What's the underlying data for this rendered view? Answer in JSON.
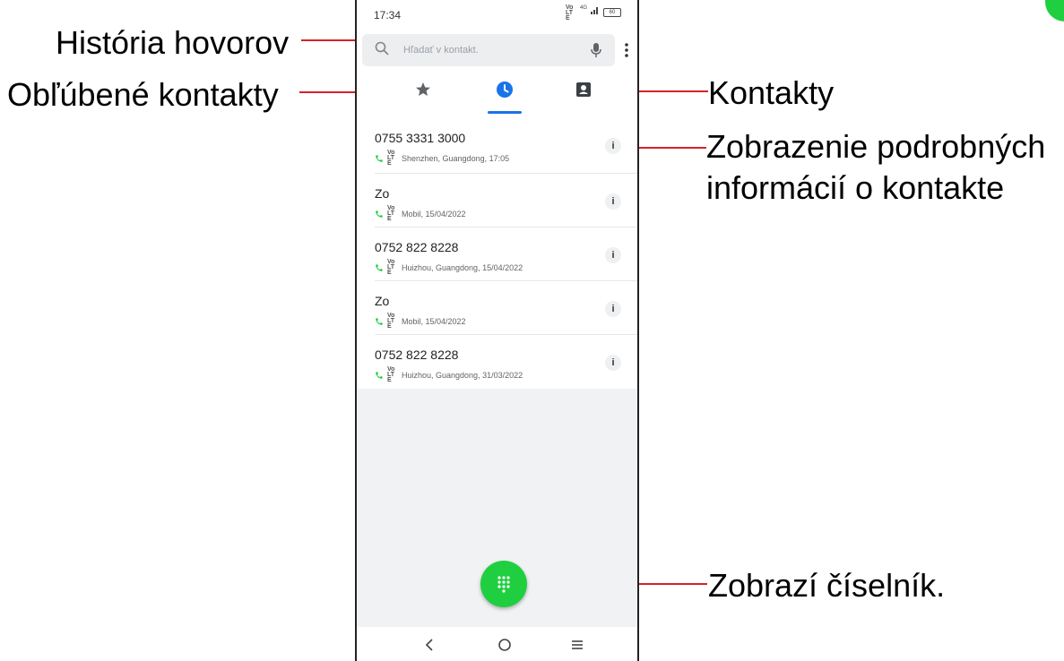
{
  "callouts": {
    "call_history": "História hovorov",
    "favorites": "Obľúbené kontakty",
    "contacts": "Kontakty",
    "details_line1": "Zobrazenie podrobných",
    "details_line2": "informácií o kontakte",
    "dialpad": "Zobrazí číselník."
  },
  "status_bar": {
    "time": "17:34",
    "network": "Vo LTE",
    "signal_label": "4G",
    "battery": "60"
  },
  "search": {
    "placeholder": "Hľadať v kontakt."
  },
  "tabs": [
    {
      "name": "favorites",
      "icon": "star-icon"
    },
    {
      "name": "call-history",
      "icon": "clock-icon",
      "selected": true
    },
    {
      "name": "contacts",
      "icon": "contact-card-icon"
    }
  ],
  "calls": [
    {
      "name": "0755 3331 3000",
      "meta": "Shenzhen, Guangdong, 17:05"
    },
    {
      "name": "Zo",
      "meta": "Mobil, 15/04/2022"
    },
    {
      "name": "0752 822 8228",
      "meta": "Huizhou, Guangdong, 15/04/2022"
    },
    {
      "name": "Zo",
      "meta": "Mobil, 15/04/2022"
    },
    {
      "name": "0752 822 8228",
      "meta": "Huizhou, Guangdong, 31/03/2022"
    }
  ],
  "call_type_label": "Vo LTE",
  "info_label": "i",
  "colors": {
    "accent": "#1a73e8",
    "fab": "#1fcf3f",
    "callout_line": "#d4232a",
    "call_icon": "#1fcf3f"
  }
}
